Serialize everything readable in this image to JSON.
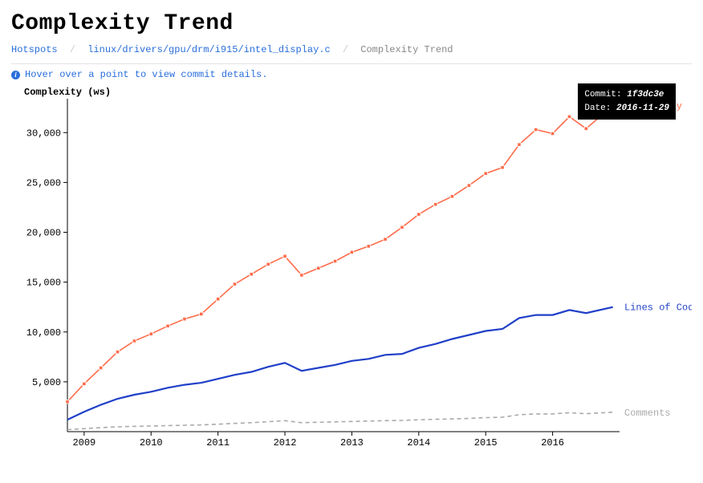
{
  "title": "Complexity Trend",
  "breadcrumb": {
    "root": "Hotspots",
    "path": "linux/drivers/gpu/drm/i915/intel_display.c",
    "current": "Complexity Trend"
  },
  "info_text": "Hover over a point to view commit details.",
  "tooltip": {
    "commit_label": "Commit:",
    "commit_value": "1f3dc3e",
    "date_label": "Date:",
    "date_value": "2016-11-29"
  },
  "chart_data": {
    "type": "line",
    "ylabel": "Complexity (ws)",
    "xlabel": "",
    "ylim": [
      0,
      33000
    ],
    "xlim": [
      2008.75,
      2017
    ],
    "y_ticks": [
      5000,
      10000,
      15000,
      20000,
      25000,
      30000
    ],
    "y_tick_labels": [
      "5,000",
      "10,000",
      "15,000",
      "20,000",
      "25,000",
      "30,000"
    ],
    "x_ticks": [
      2009,
      2010,
      2011,
      2012,
      2013,
      2014,
      2015,
      2016
    ],
    "x_tick_labels": [
      "2009",
      "2010",
      "2011",
      "2012",
      "2013",
      "2014",
      "2015",
      "2016"
    ],
    "x": [
      2008.75,
      2009.0,
      2009.25,
      2009.5,
      2009.75,
      2010.0,
      2010.25,
      2010.5,
      2010.75,
      2011.0,
      2011.25,
      2011.5,
      2011.75,
      2012.0,
      2012.25,
      2012.5,
      2012.75,
      2013.0,
      2013.25,
      2013.5,
      2013.75,
      2014.0,
      2014.25,
      2014.5,
      2014.75,
      2015.0,
      2015.25,
      2015.5,
      2015.75,
      2016.0,
      2016.25,
      2016.5,
      2016.9
    ],
    "series": [
      {
        "name": "Complexity",
        "color": "#ff6b4a",
        "label_align": "start",
        "points": true,
        "values": [
          3000,
          4800,
          6400,
          8000,
          9100,
          9800,
          10600,
          11300,
          11800,
          13300,
          14800,
          15800,
          16800,
          17600,
          15700,
          16400,
          17100,
          18000,
          18600,
          19300,
          20500,
          21800,
          22800,
          23600,
          24700,
          25900,
          26500,
          28800,
          30300,
          29900,
          31600,
          30400,
          32700
        ]
      },
      {
        "name": "Lines of Code",
        "color": "#2040c8",
        "label_align": "start",
        "points": false,
        "values": [
          1200,
          2000,
          2700,
          3300,
          3700,
          4000,
          4400,
          4700,
          4900,
          5300,
          5700,
          6000,
          6500,
          6900,
          6100,
          6400,
          6700,
          7100,
          7300,
          7700,
          7800,
          8400,
          8800,
          9300,
          9700,
          10100,
          10300,
          11400,
          11700,
          11700,
          12200,
          11900,
          12500
        ]
      },
      {
        "name": "Comments",
        "color": "#aaaaaa",
        "label_align": "start",
        "points": false,
        "values": [
          200,
          300,
          400,
          480,
          530,
          560,
          600,
          640,
          680,
          750,
          830,
          900,
          1000,
          1100,
          900,
          940,
          980,
          1020,
          1060,
          1100,
          1130,
          1190,
          1240,
          1280,
          1330,
          1410,
          1450,
          1700,
          1780,
          1780,
          1900,
          1800,
          1950
        ]
      }
    ]
  }
}
